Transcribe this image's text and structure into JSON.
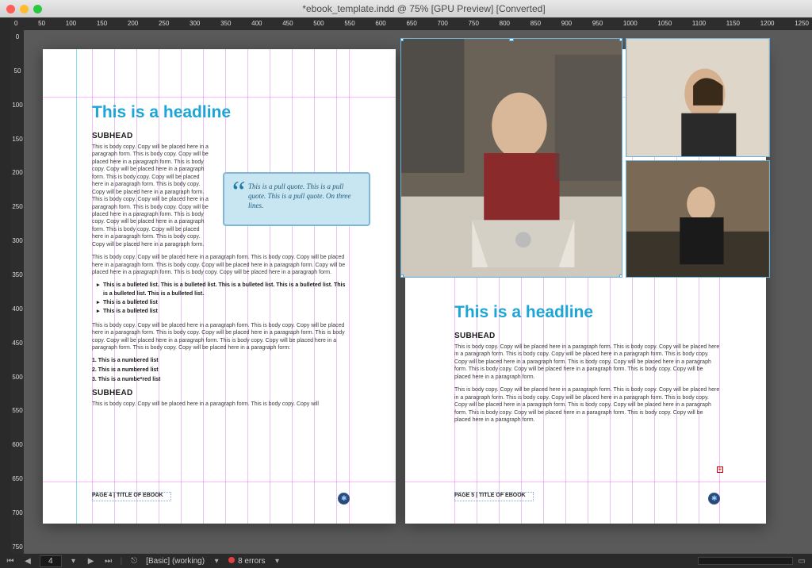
{
  "window": {
    "title": "*ebook_template.indd @ 75% [GPU Preview] [Converted]"
  },
  "ruler_top": [
    "0",
    "50",
    "100",
    "150",
    "200",
    "250",
    "300",
    "350",
    "400",
    "450",
    "500",
    "550",
    "600",
    "650",
    "700",
    "750",
    "800",
    "850",
    "900",
    "950",
    "1000",
    "1050",
    "1100",
    "1150",
    "1200",
    "1250"
  ],
  "ruler_left": [
    "0",
    "50",
    "100",
    "150",
    "200",
    "250",
    "300",
    "350",
    "400",
    "450",
    "500",
    "550",
    "600",
    "650",
    "700",
    "750"
  ],
  "left_page": {
    "headline": "This is a headline",
    "subhead1": "SUBHEAD",
    "body1": "This is body copy. Copy will be placed here in a paragraph form. This is body copy. Copy will be placed here in a paragraph form. This is body copy. Copy will be placed here in a paragraph form. This is body copy. Copy will be placed here in a paragraph form. This is body copy. Copy will be placed here in a paragraph form. This is body copy. Copy will be placed here in a paragraph form. This is body copy. Copy will be placed here in a paragraph form. This is body copy. Copy will be placed here in a paragraph form. This is body copy. Copy will be placed here in a paragraph form. This is body copy. Copy will be placed here in a paragraph form.",
    "pullquote": "This is a pull quote. This is a pull quote. This is a pull quote. On three lines.",
    "body2": "This is body copy. Copy will be placed here in a paragraph form. This is body copy. Copy will be placed here in a paragraph form. This is body copy. Copy will be placed here in a paragraph form. Copy will be placed here in a paragraph form. This is body copy. Copy will be placed here in a paragraph form.",
    "bullets": [
      "This is a bulleted list. This is a bulleted list. This is a bulleted list. This is a bulleted list. This is a bulleted list. This is a bulleted list.",
      "This is a bulleted list",
      "This is a bulleted list"
    ],
    "body3": "This is body copy. Copy will be placed here in a paragraph form. This is body copy. Copy will be placed here in a paragraph form. This is body copy. Copy will be placed here in a paragraph form. This is body copy. Copy will be placed here in a paragraph form. This is body copy. Copy will be placed here in a paragraph form. This is body copy. Copy will be placed here in a paragraph form:",
    "numbered": [
      "1. This is a numbered list",
      "2. This is a numbered list",
      "3. This is a numbe*red list"
    ],
    "subhead2": "SUBHEAD",
    "body4": "This is body copy. Copy will be placed here in a paragraph form. This is body copy. Copy will",
    "footer": "PAGE 4  |  TITLE OF EBOOK"
  },
  "right_page": {
    "headline": "This is a headline",
    "subhead": "SUBHEAD",
    "body1": "This is body copy. Copy will be placed here in a paragraph form. This is body copy. Copy will be placed here in a paragraph form. This is body copy. Copy will be placed here in a paragraph form. This is body copy. Copy will be placed here in a paragraph form. This is body copy. Copy will be placed here in a paragraph form. This is body copy. Copy will be placed here in a paragraph form. This is body copy. Copy will be placed here in a paragraph form.",
    "body2": "This is body copy. Copy will be placed here in a paragraph form. This is body copy. Copy will be placed here in a paragraph form. This is body copy. Copy will be placed here in a paragraph form. This is body copy. Copy will be placed here in a paragraph form. This is body copy. Copy will be placed here in a paragraph form. This is body copy. Copy will be placed here in a paragraph form. This is body copy. Copy will be placed here in a paragraph form.",
    "footer": "PAGE 5  |  TITLE OF EBOOK"
  },
  "status": {
    "page_field": "4",
    "style": "[Basic] (working)",
    "errors": "8 errors"
  }
}
